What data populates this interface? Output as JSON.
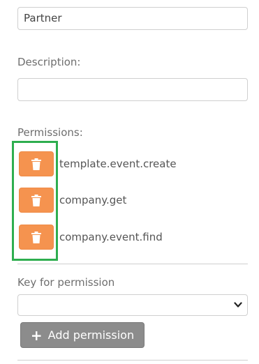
{
  "name_field": {
    "value": "Partner"
  },
  "description": {
    "label": "Description:",
    "value": ""
  },
  "permissions": {
    "label": "Permissions:",
    "items": [
      {
        "label": "template.event.create",
        "icon": "trash-icon"
      },
      {
        "label": "company.get",
        "icon": "trash-icon"
      },
      {
        "label": "company.event.find",
        "icon": "trash-icon"
      }
    ]
  },
  "key_for_permission": {
    "label": "Key for permission",
    "selected": ""
  },
  "add_button": {
    "label": "Add permission",
    "icon": "plus-icon"
  },
  "colors": {
    "delete_button": "#f5934f",
    "highlight": "#2eae4f",
    "add_button": "#8c8c8c"
  }
}
